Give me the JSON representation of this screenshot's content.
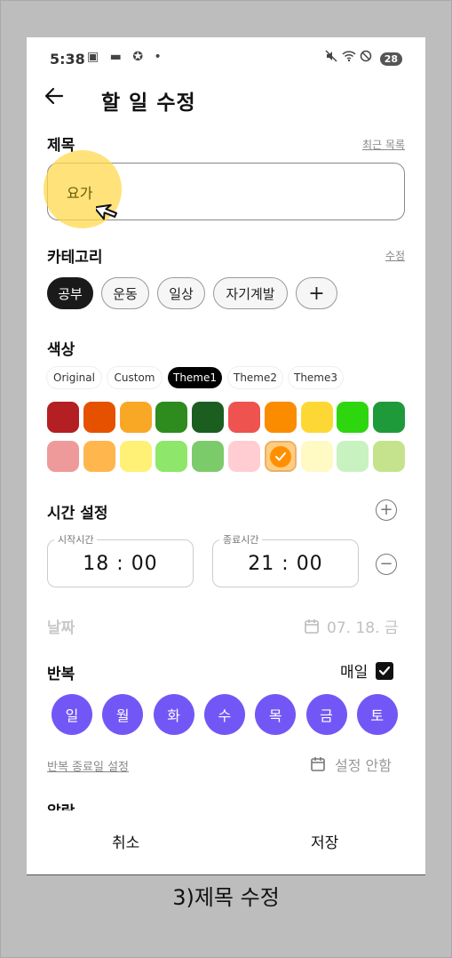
{
  "status": {
    "time": "5:38",
    "left_icons": "▣ ▬ ✪ •",
    "right_icons": "🔇 ◌ ⊘",
    "battery": "28"
  },
  "header": {
    "title": "할 일 수정",
    "back_icon": "arrow-left-icon"
  },
  "title_section": {
    "label": "제목",
    "recent_link": "최근 목록",
    "input_value": "요가"
  },
  "category": {
    "label": "카테고리",
    "edit_link": "수정",
    "chips": [
      "공부",
      "운동",
      "일상",
      "자기계발"
    ],
    "selected": "공부",
    "add_label": "+"
  },
  "color": {
    "label": "색상",
    "themes": [
      "Original",
      "Custom",
      "Theme1",
      "Theme2",
      "Theme3"
    ],
    "selected_theme": "Theme1",
    "row1": [
      "#b41f23",
      "#e65100",
      "#f9a825",
      "#2e8b1e",
      "#1b5e20",
      "#ef5350",
      "#fb8c00",
      "#fdd835",
      "#2ed60f",
      "#1e9a3a"
    ],
    "row2": [
      "#ef9a9a",
      "#ffb74d",
      "#fff176",
      "#8ee66a",
      "#7ccb6a",
      "#ffcdd2",
      "#ffcc80",
      "#fff9c4",
      "#c8f2c0",
      "#c5e38c"
    ],
    "selected_swatch": "row2-6"
  },
  "time": {
    "label": "시간 설정",
    "start_label": "시작시간",
    "start_value": "18 : 00",
    "end_label": "종료시간",
    "end_value": "21 : 00"
  },
  "date": {
    "label": "날짜",
    "value": "07. 18. 금"
  },
  "repeat": {
    "label": "반복",
    "daily_label": "매일",
    "daily_checked": true,
    "days": [
      "일",
      "월",
      "화",
      "수",
      "목",
      "금",
      "토"
    ],
    "end_link": "반복 종료일 설정",
    "end_value": "설정 안함"
  },
  "alarm": {
    "label_partial": "알람"
  },
  "footer": {
    "cancel": "취소",
    "save": "저장"
  },
  "caption": "3)제목 수정"
}
